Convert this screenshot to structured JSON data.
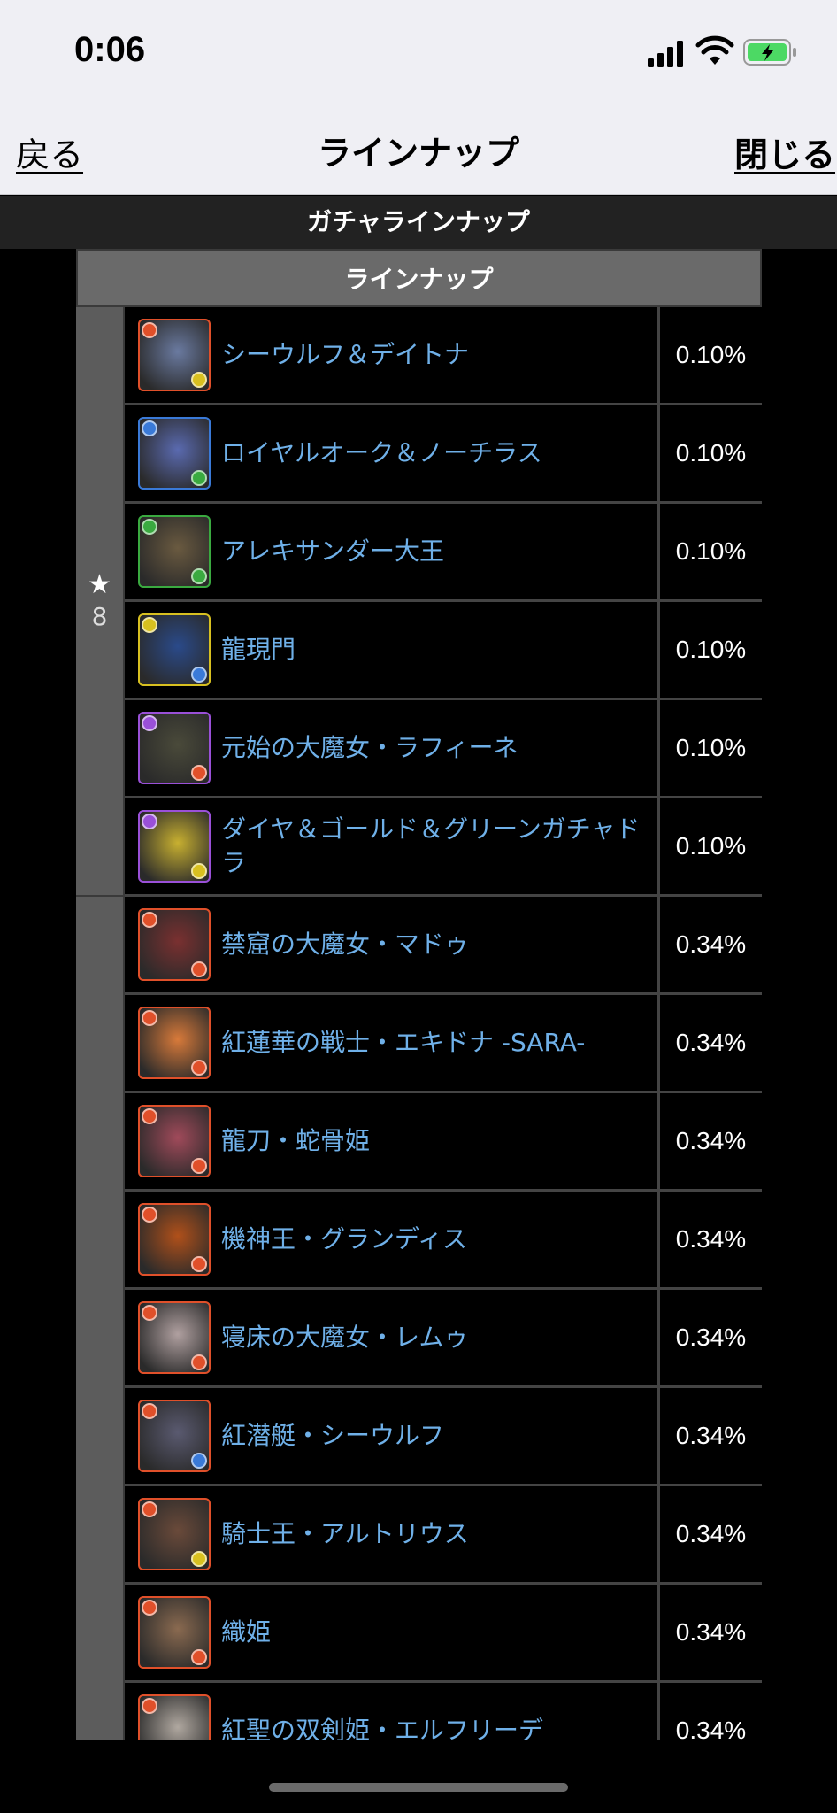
{
  "status_bar": {
    "time": "0:06",
    "icons": [
      "cellular-signal-icon",
      "wifi-icon",
      "battery-charging-icon"
    ],
    "battery_color": "#4cd964"
  },
  "nav": {
    "back_label": "戻る",
    "title": "ラインナップ",
    "close_label": "閉じる"
  },
  "page_header": "ガチャラインナップ",
  "lineup": {
    "header": "ラインナップ",
    "groups": [
      {
        "rarity_star": "★",
        "rarity": "8",
        "items": [
          {
            "name": "シーウルフ＆デイトナ",
            "rate": "0.10%",
            "attr": "#e0502a",
            "sub": "#d8c020",
            "tone": "#6a7aa0"
          },
          {
            "name": "ロイヤルオーク＆ノーチラス",
            "rate": "0.10%",
            "attr": "#3a7ad8",
            "sub": "#3aaa40",
            "tone": "#5a6ab0"
          },
          {
            "name": "アレキサンダー大王",
            "rate": "0.10%",
            "attr": "#3aaa40",
            "sub": "#3aaa40",
            "tone": "#6a5a40"
          },
          {
            "name": "龍現門",
            "rate": "0.10%",
            "attr": "#d8c020",
            "sub": "#3a7ad8",
            "tone": "#2a4a8a"
          },
          {
            "name": "元始の大魔女・ラフィーネ",
            "rate": "0.10%",
            "attr": "#9a50d8",
            "sub": "#e0502a",
            "tone": "#4a4a3a"
          },
          {
            "name": "ダイヤ＆ゴールド＆グリーンガチャドラ",
            "rate": "0.10%",
            "attr": "#9a50d8",
            "sub": "#d8c020",
            "tone": "#c8b030"
          }
        ]
      },
      {
        "rarity_star": "",
        "rarity": "",
        "items": [
          {
            "name": "禁窟の大魔女・マドゥ",
            "rate": "0.34%",
            "attr": "#e0502a",
            "sub": "#e0502a",
            "tone": "#7a3030"
          },
          {
            "name": "紅蓮華の戦士・エキドナ -SARA-",
            "rate": "0.34%",
            "attr": "#e0502a",
            "sub": "#e0502a",
            "tone": "#d87a3a"
          },
          {
            "name": "龍刀・蛇骨姫",
            "rate": "0.34%",
            "attr": "#e0502a",
            "sub": "#e0502a",
            "tone": "#a04a5a"
          },
          {
            "name": "機神王・グランディス",
            "rate": "0.34%",
            "attr": "#e0502a",
            "sub": "#e0502a",
            "tone": "#b0501a"
          },
          {
            "name": "寝床の大魔女・レムゥ",
            "rate": "0.34%",
            "attr": "#e0502a",
            "sub": "#e0502a",
            "tone": "#b0a0a0"
          },
          {
            "name": "紅潜艇・シーウルフ",
            "rate": "0.34%",
            "attr": "#e0502a",
            "sub": "#3a7ad8",
            "tone": "#5a5a70"
          },
          {
            "name": "騎士王・アルトリウス",
            "rate": "0.34%",
            "attr": "#e0502a",
            "sub": "#d8c020",
            "tone": "#6a4a3a"
          },
          {
            "name": "織姫",
            "rate": "0.34%",
            "attr": "#e0502a",
            "sub": "#e0502a",
            "tone": "#8a6a50"
          },
          {
            "name": "紅聖の双剣姫・エルフリーデ",
            "rate": "0.34%",
            "attr": "#e0502a",
            "sub": "#e0502a",
            "tone": "#b0a8a0"
          }
        ]
      }
    ]
  }
}
